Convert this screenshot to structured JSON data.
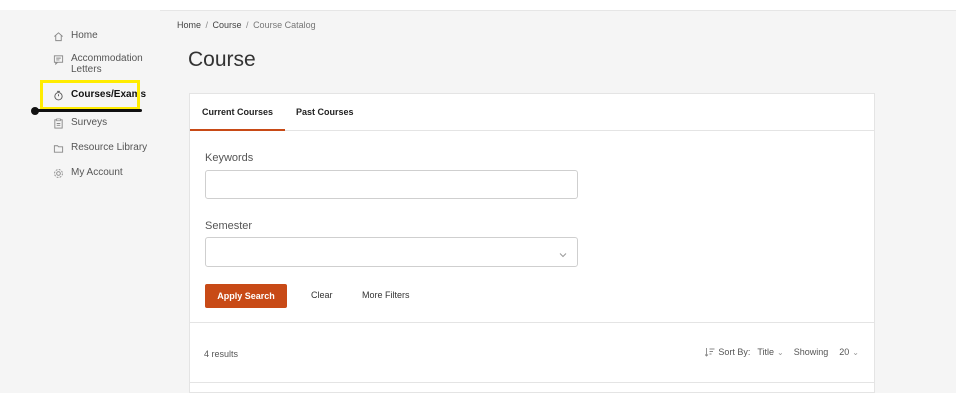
{
  "sidebar": {
    "items": [
      {
        "label": "Home",
        "icon": "home-icon"
      },
      {
        "label": "Accommodation Letters",
        "icon": "letter-icon"
      },
      {
        "label": "Courses/Exams",
        "icon": "timer-icon"
      },
      {
        "label": "Surveys",
        "icon": "clipboard-icon"
      },
      {
        "label": "Resource Library",
        "icon": "folder-icon"
      },
      {
        "label": "My Account",
        "icon": "gear-icon"
      }
    ]
  },
  "breadcrumb": {
    "home": "Home",
    "course": "Course",
    "current": "Course Catalog"
  },
  "page_title": "Course",
  "tabs": {
    "current": "Current Courses",
    "past": "Past Courses"
  },
  "form": {
    "keywords_label": "Keywords",
    "keywords_value": "",
    "semester_label": "Semester",
    "semester_value": "",
    "apply": "Apply Search",
    "clear": "Clear",
    "more_filters": "More Filters"
  },
  "results": {
    "count_text": "4 results",
    "sort_by_label": "Sort By:",
    "sort_value": "Title",
    "showing_label": "Showing",
    "showing_value": "20"
  },
  "colors": {
    "accent": "#c84a16",
    "highlight": "#ffec00"
  }
}
